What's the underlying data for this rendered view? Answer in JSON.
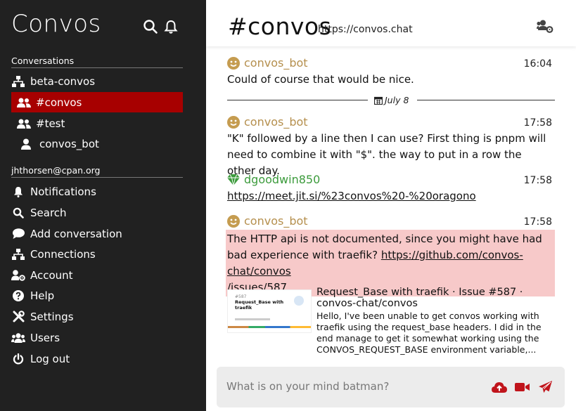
{
  "sidebar": {
    "brand": "Convos",
    "sections": {
      "conversations": "Conversations",
      "account": "jhthorsen@cpan.org"
    },
    "conversations": [
      {
        "label": "beta-convos",
        "icon": "network-icon"
      },
      {
        "label": "#convos",
        "icon": "users-icon",
        "active": true
      },
      {
        "label": "#test",
        "icon": "users-icon"
      },
      {
        "label": "convos_bot",
        "icon": "user-icon"
      }
    ],
    "menu": [
      {
        "label": "Notifications",
        "icon": "bell-icon"
      },
      {
        "label": "Search",
        "icon": "search-icon"
      },
      {
        "label": "Add conversation",
        "icon": "comment-icon"
      },
      {
        "label": "Connections",
        "icon": "network-icon"
      },
      {
        "label": "Account",
        "icon": "user-cog-icon"
      },
      {
        "label": "Help",
        "icon": "question-circle-icon"
      },
      {
        "label": "Settings",
        "icon": "tools-icon"
      },
      {
        "label": "Users",
        "icon": "users-icon"
      },
      {
        "label": "Log out",
        "icon": "power-icon"
      }
    ]
  },
  "channel": {
    "title": "#convos",
    "url": "https://convos.chat"
  },
  "messages": [
    {
      "from": "convos_bot",
      "time": "16:04",
      "text": "Could of course that would be nice."
    },
    {
      "from": "convos_bot",
      "time": "17:58",
      "text": "\"K\" followed by a line then I can use? First thing is pnpm will need to combine it with \"$\". the way to put in a row the other day."
    },
    {
      "from": "dgoodwin850",
      "time": "17:58",
      "link": "https://meet.jit.si/%23convos%20-%20oragono"
    },
    {
      "from": "convos_bot",
      "time": "17:58",
      "text_before": "The HTTP api is not documented, since you might have had bad experience with traefik? ",
      "link_line1": "https://github.com/convos-chat/convos",
      "link_line2": "/issues/587"
    }
  ],
  "day_separator": "July 8",
  "preview": {
    "title": "Request_Base with traefik · Issue #587 · convos-chat/convos",
    "description": "Hello, I've been unable to get convos working with traefik using the request_base headers. I did in the end manage to get it somewhat working using the CONVOS_REQUEST_BASE environment variable,...",
    "thumb_heading": "Request_Base with traefik",
    "thumb_number": "#587"
  },
  "composer": {
    "placeholder": "What is on your mind batman?"
  },
  "colors": {
    "sidebar_bg": "#212121",
    "active_bg": "#a70000",
    "accent": "#c0141b",
    "bot_name": "#b58f4d",
    "user_name": "#3c9b3c",
    "highlight_bg": "#f7c9c9"
  }
}
